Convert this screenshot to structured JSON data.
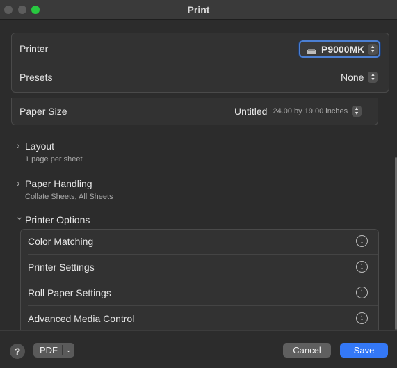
{
  "window": {
    "title": "Print"
  },
  "printer": {
    "label": "Printer",
    "value": "P9000MK"
  },
  "presets": {
    "label": "Presets",
    "value": "None"
  },
  "paper_size": {
    "label": "Paper Size",
    "value": "Untitled",
    "dimensions": "24.00 by 19.00 inches"
  },
  "sections": {
    "layout": {
      "title": "Layout",
      "subtitle": "1 page per sheet"
    },
    "paper_handling": {
      "title": "Paper Handling",
      "subtitle": "Collate Sheets, All Sheets"
    },
    "printer_options": {
      "title": "Printer Options"
    }
  },
  "printer_options": [
    {
      "label": "Color Matching"
    },
    {
      "label": "Printer Settings"
    },
    {
      "label": "Roll Paper Settings"
    },
    {
      "label": "Advanced Media Control"
    }
  ],
  "icons": {
    "info": "i",
    "help": "?",
    "chevron_right": "›",
    "chevron_down": "⌄",
    "popup_up": "▲",
    "popup_down": "▼",
    "printer": "printer-icon"
  },
  "footer": {
    "help_label": "?",
    "pdf_label": "PDF",
    "cancel_label": "Cancel",
    "save_label": "Save"
  },
  "colors": {
    "accent": "#3478f6",
    "focus_ring": "#4b7fd3",
    "close_light": "#28c840"
  }
}
